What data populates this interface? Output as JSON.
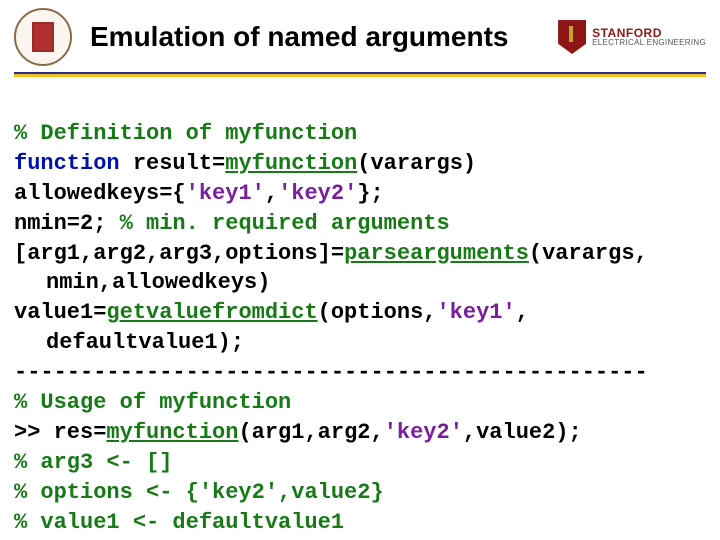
{
  "header": {
    "title": "Emulation of named arguments",
    "logo_line1": "STANFORD",
    "logo_line2": "ELECTRICAL ENGINEERING"
  },
  "code": {
    "l1": "% Definition of myfunction",
    "l2a": "function",
    "l2b": " result=",
    "l2c": "myfunction",
    "l2d": "(varargs)",
    "l3a": "allowedkeys={",
    "l3b": "'key1'",
    "l3c": ",",
    "l3d": "'key2'",
    "l3e": "};",
    "l4a": "nmin=2; ",
    "l4b": "% min. required arguments",
    "l5a": "[arg1,arg2,arg3,options]=",
    "l5b": "parsearguments",
    "l5c": "(varargs,",
    "l5d": "nmin,allowedkeys)",
    "l6a": "value1=",
    "l6b": "getvaluefromdict",
    "l6c": "(options,",
    "l6d": "'key1'",
    "l6e": ",",
    "l6f": "defaultvalue1);",
    "l7": "------------------------------------------------",
    "l8": "% Usage of myfunction",
    "l9a": ">> res=",
    "l9b": "myfunction",
    "l9c": "(arg1,arg2,",
    "l9d": "'key2'",
    "l9e": ",value2);",
    "l10": "% arg3 <- []",
    "l11": "% options <- {'key2',value2}",
    "l12": "% value1 <- defaultvalue1"
  }
}
